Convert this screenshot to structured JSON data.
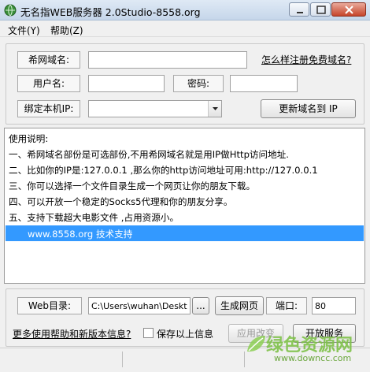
{
  "window": {
    "title": "无名指WEB服务器 2.0Studio-8558.org",
    "icon": "globe-icon",
    "controls": [
      "minimize-icon",
      "maximize-icon",
      "close-icon"
    ]
  },
  "menu": {
    "file": "文件(Y)",
    "help": "帮助(Z)"
  },
  "form": {
    "domain_label": "希网域名:",
    "domain_value": "",
    "register_link": "怎么样注册免费域名?",
    "user_label": "用户名:",
    "user_value": "",
    "password_label": "密码:",
    "password_value": "",
    "bind_ip_label": "绑定本机IP:",
    "bind_ip_value": "",
    "update_button": "更新域名到 IP"
  },
  "instructions": {
    "lines": [
      "使用说明:",
      "一、希网域名部份是可选部份,不用希网域名就是用IP做Http访问地址.",
      "二、比如你的IP是:127.0.0.1 ,那么你的http访问地址可用:http://127.0.0.1",
      "三、你可以选择一个文件目录生成一个网页让你的朋友下载。",
      "四、可以开放一个稳定的Socks5代理和你的朋友分享。",
      "五、支持下载超大电影文件 ,占用资源小。"
    ],
    "highlighted": "www.8558.org 技术支持"
  },
  "bottom": {
    "web_dir_label": "Web目录:",
    "web_dir_value": "C:\\Users\\wuhan\\Desktop\\T",
    "browse_button": "...",
    "generate_button": "生成网页",
    "port_label": "端口:",
    "port_value": "80",
    "help_link": "更多使用帮助和新版本信息?",
    "save_checkbox_label": "保存以上信息",
    "save_checked": false,
    "apply_button": "应用改变",
    "start_button": "开放服务"
  },
  "watermark": {
    "main": "绿色资源网",
    "sub": "www.downcc.com"
  },
  "colors": {
    "selection": "#3399ff",
    "titlebar": "#c6d6ea",
    "close": "#c6442a",
    "watermark": "#7fc24a"
  }
}
